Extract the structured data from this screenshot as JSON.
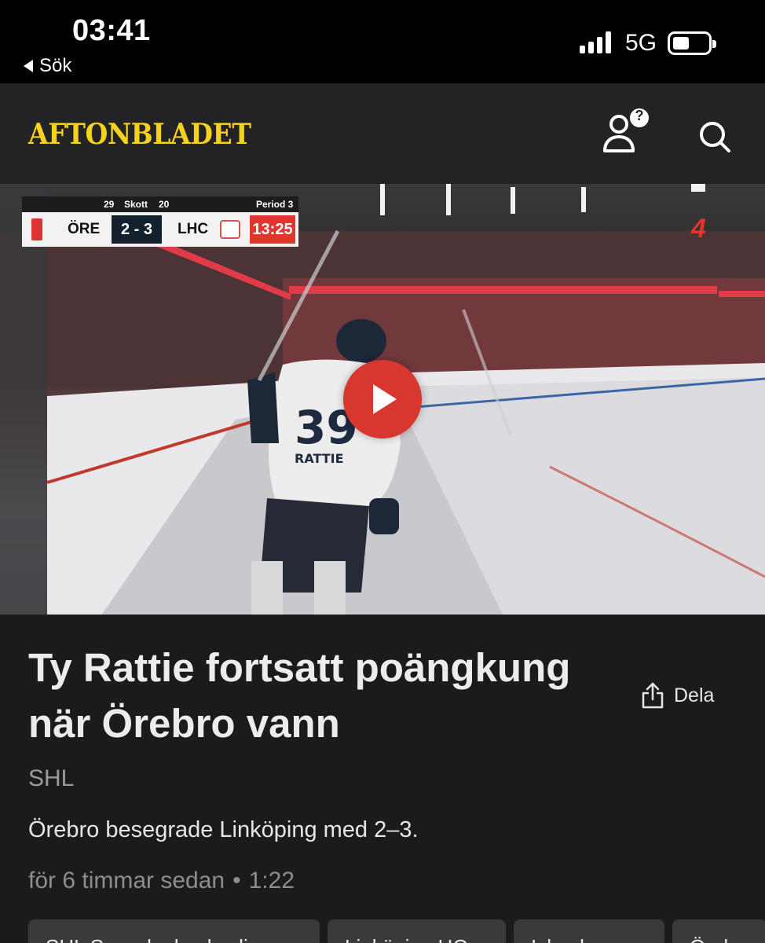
{
  "status_bar": {
    "time": "03:41",
    "back_label": "Sök",
    "network": "5G"
  },
  "header": {
    "logo_text": "AFTONBLADET",
    "notification_badge": "?"
  },
  "video": {
    "scoreboard": {
      "shots_home": "29",
      "shots_label": "Skott",
      "shots_away": "20",
      "period": "Period 3",
      "home_team": "ÖRE",
      "score": "2 - 3",
      "away_team": "LHC",
      "clock": "13:25"
    },
    "channel": "4"
  },
  "article": {
    "title": "Ty Rattie fortsatt poängkung när Örebro vann",
    "share_label": "Dela",
    "category": "SHL",
    "lead": "Örebro besegrade Linköping med 2–3.",
    "published": "för 6 timmar sedan",
    "separator": "•",
    "duration": "1:22",
    "tags": [
      "SHL Svenska hockeyligan",
      "Linköping HC",
      "Ishockey",
      "Örebro"
    ]
  },
  "colors": {
    "brand": "#f5d21c",
    "accent": "#d8372f",
    "background": "#1b1b1d",
    "header": "#232326"
  }
}
